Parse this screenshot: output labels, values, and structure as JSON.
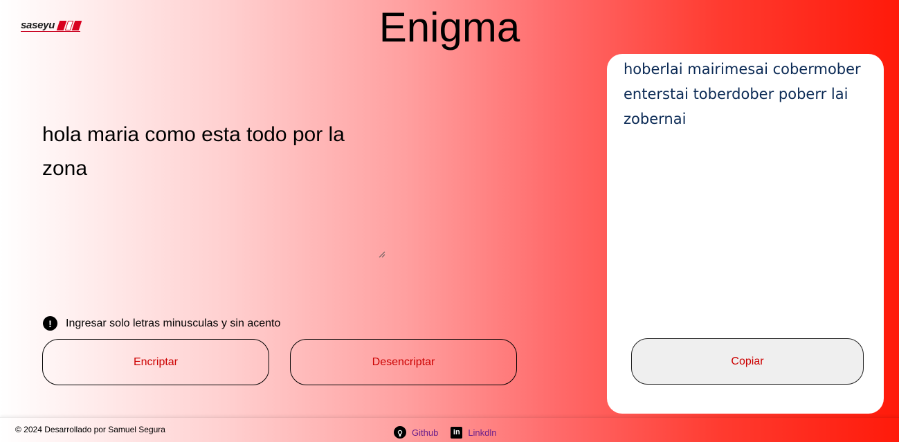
{
  "header": {
    "logo_text": "saseyu",
    "title": "Enigma"
  },
  "input": {
    "value": "hola maria como esta todo por la zona"
  },
  "warning": {
    "icon": "exclamation-circle-icon",
    "text": "Ingresar solo letras minusculas y sin acento"
  },
  "buttons": {
    "encrypt_label": "Encriptar",
    "decrypt_label": "Desencriptar",
    "copy_label": "Copiar"
  },
  "output": {
    "text": "hoberlai mairimesai cobermober enterstai toberdober poberr lai zobernai"
  },
  "footer": {
    "copyright": "© 2024 Desarrollado por Samuel Segura",
    "github_label": "Github",
    "linkedin_label": "Linkdln"
  },
  "colors": {
    "accent": "#cc0000",
    "output_text": "#0b2a55",
    "link": "#6b1f8a"
  }
}
